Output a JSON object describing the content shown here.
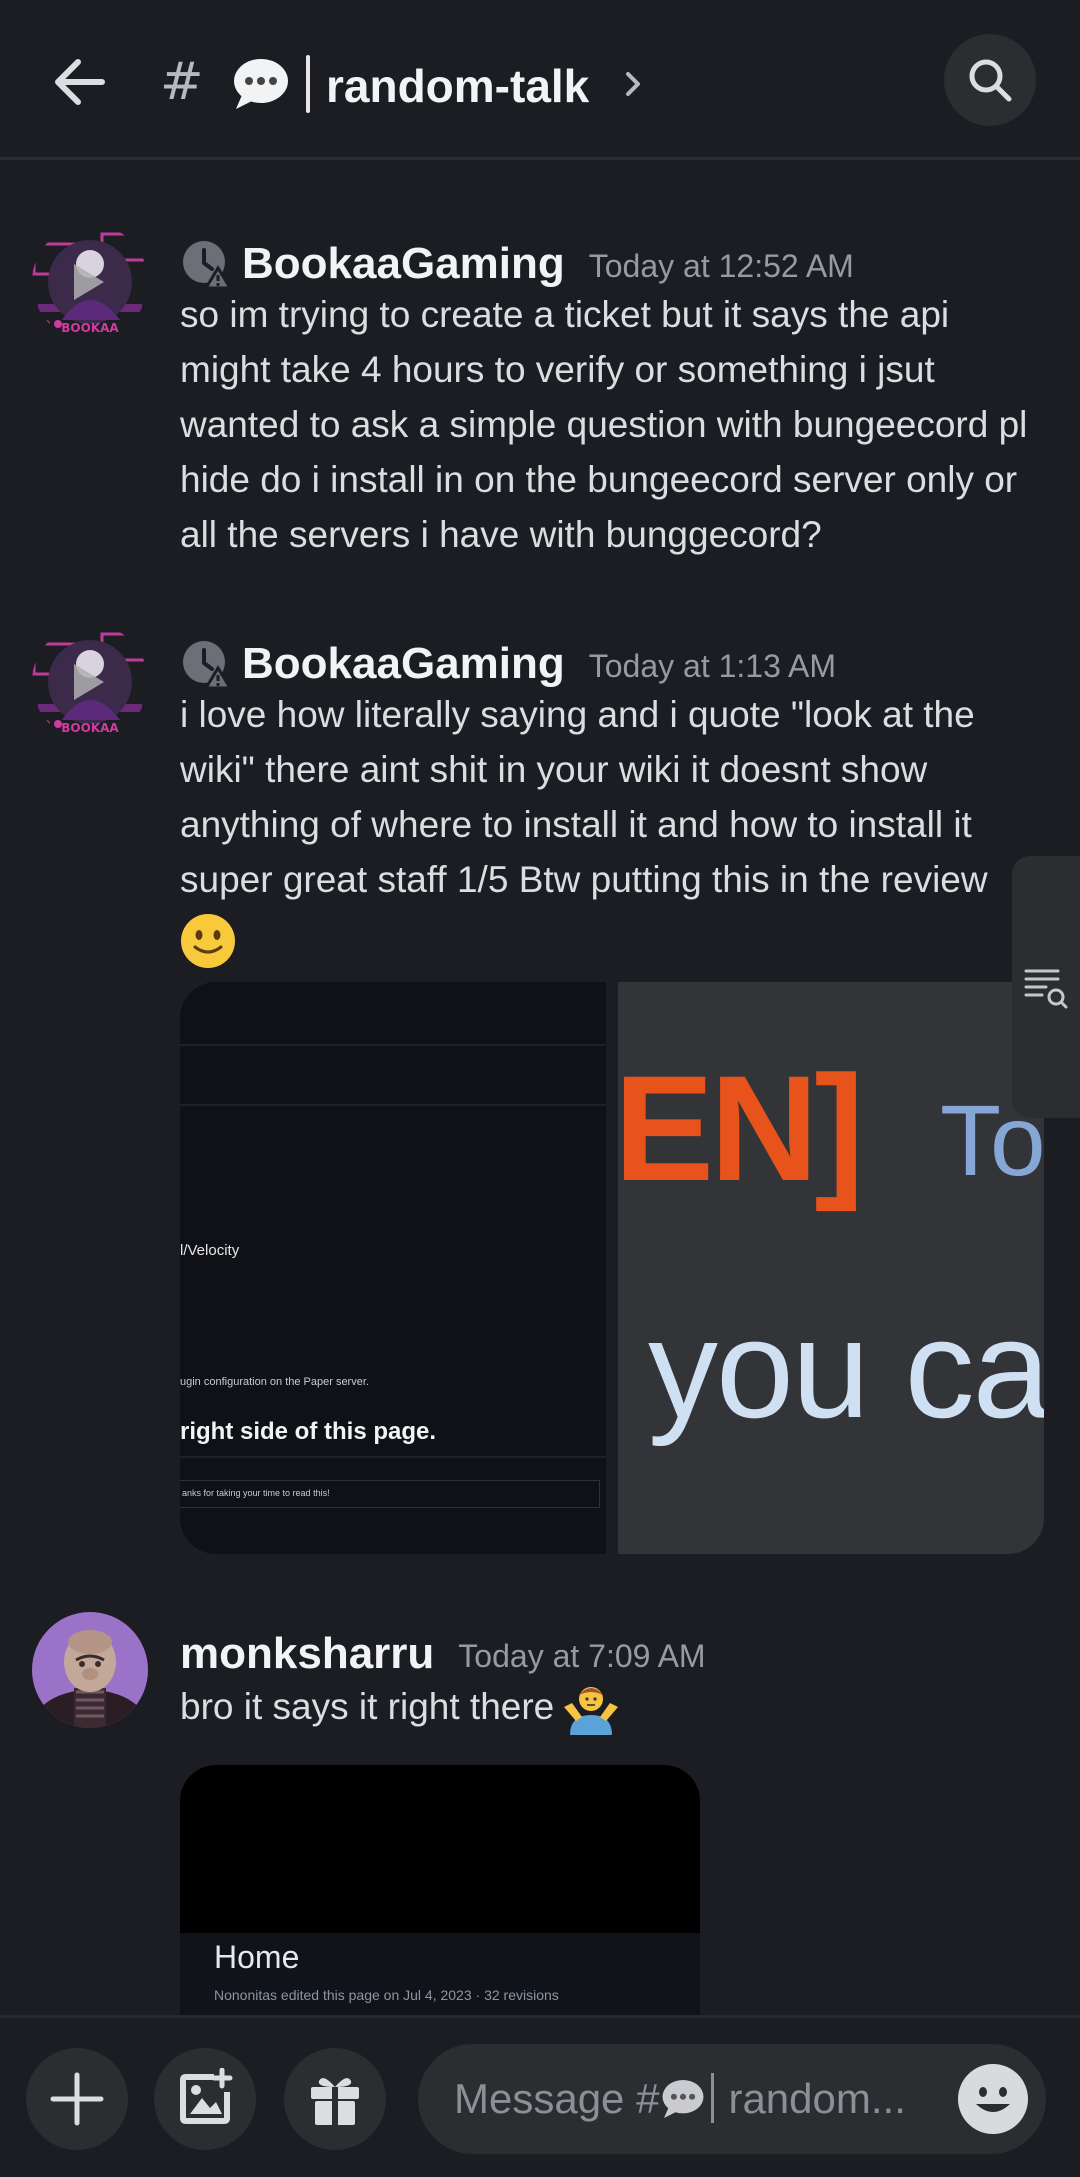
{
  "header": {
    "hash": "#",
    "channel_name": "random-talk"
  },
  "messages": [
    {
      "author": "BookaaGaming",
      "timestamp": "Today at 12:52 AM",
      "text": "so im trying to create a ticket but it says the api might take 4 hours to verify or something i jsut wanted to ask a simple question with bungeecord pl hide do i install in on the bungeecord server only or all the servers i have with bunggecord?"
    },
    {
      "author": "BookaaGaming",
      "timestamp": "Today at 1:13 AM",
      "text": "i love how literally saying and i quote \"look at the wiki\" there aint shit in your wiki it doesnt show anything of where to install it and how to install it super great staff 1/5 Btw putting this in the review",
      "attachments": {
        "left": {
          "line1": "l/Velocity",
          "line2": "ugin configuration on the Paper server.",
          "line3": "right side of this page.",
          "line4": "anks for taking your time to read this!"
        },
        "right": {
          "line1_orange": "EN]",
          "line1_blue": "To",
          "line2": "you ca"
        }
      }
    },
    {
      "author": "monksharru",
      "timestamp": "Today at 7:09 AM",
      "text": "bro it says it right there",
      "attachment": {
        "title": "Home",
        "subtitle": "Nononitas edited this page on Jul 4, 2023 · 32 revisions"
      }
    }
  ],
  "composer": {
    "placeholder_prefix": "Message #",
    "placeholder_suffix": "random..."
  },
  "colors": {
    "background": "#1c1d22",
    "surface": "#2b2d31",
    "text": "#dbdee1",
    "muted": "#949ba4",
    "accent_orange": "#e8531c",
    "accent_blue": "#8fb4e8"
  }
}
